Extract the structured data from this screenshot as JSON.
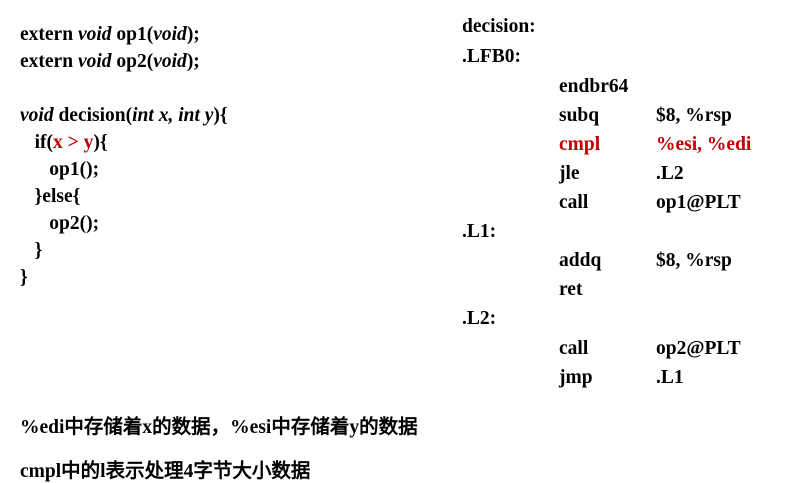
{
  "c_code": {
    "extern1": {
      "kw": "extern",
      "ty": "void",
      "name": "op1(",
      "ty2": "void",
      "end": ");"
    },
    "extern2": {
      "kw": "extern",
      "ty": "void",
      "name": "op2(",
      "ty2": "void",
      "end": ");"
    },
    "sig": {
      "ty": "void",
      "name": "decision(",
      "t1": "int",
      "p1": "x,",
      "t2": "int",
      "p2": "y",
      "end": "){"
    },
    "if_line": {
      "pre": "if(",
      "cond": "x > y",
      "post": "){"
    },
    "call1": "op1();",
    "else_line": "}else{",
    "call2": "op2();",
    "close_inner": "}",
    "close_outer": "}"
  },
  "asm": {
    "func_label": "decision:",
    "lfb0": ".LFB0:",
    "endbr": "endbr64",
    "subq": {
      "op": "subq",
      "arg": "$8, %rsp"
    },
    "cmpl": {
      "op": "cmpl",
      "arg": "%esi, %edi"
    },
    "jle": {
      "op": "jle",
      "arg": ".L2"
    },
    "call1": {
      "op": "call",
      "arg": "op1@PLT"
    },
    "l1": ".L1:",
    "addq": {
      "op": "addq",
      "arg": "$8, %rsp"
    },
    "ret": "ret",
    "l2": ".L2:",
    "call2": {
      "op": "call",
      "arg": "op2@PLT"
    },
    "jmp": {
      "op": "jmp",
      "arg": ".L1"
    }
  },
  "notes": {
    "note1": "%edi中存储着x的数据，%esi中存储着y的数据",
    "note2": "cmpl中的l表示处理4字节大小数据"
  },
  "colors": {
    "highlight": "#c00000",
    "text": "#000000"
  }
}
